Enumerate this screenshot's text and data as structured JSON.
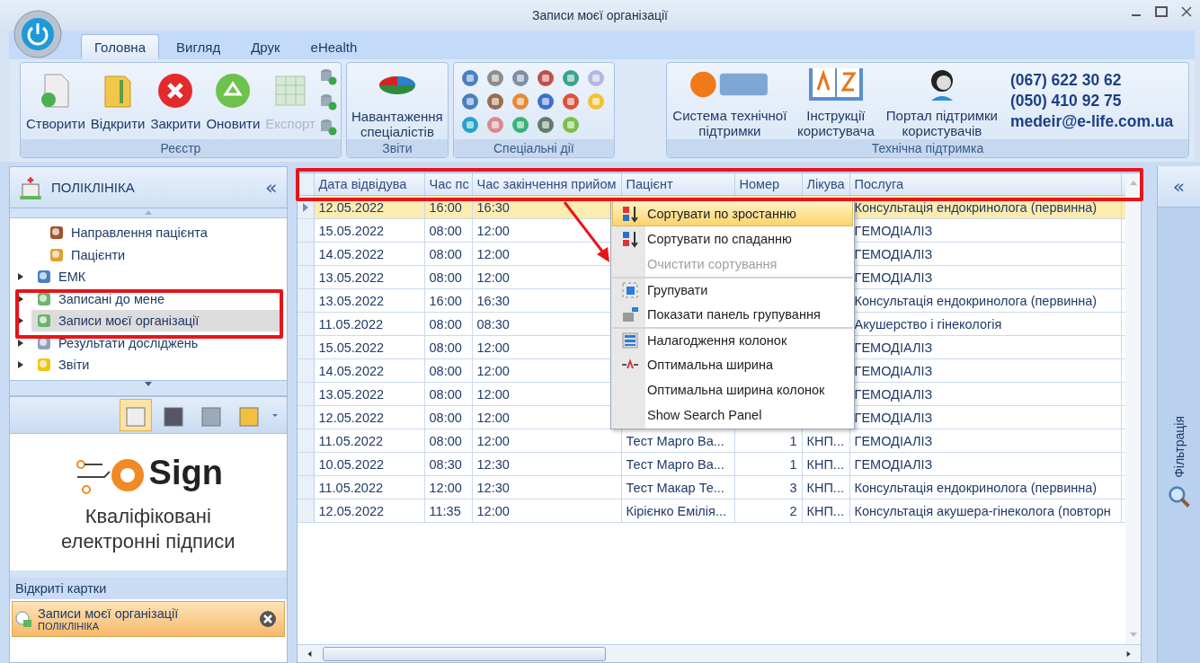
{
  "window": {
    "title": "Записи моєї організації"
  },
  "tabs": [
    {
      "label": "Головна",
      "selected": true
    },
    {
      "label": "Вигляд",
      "selected": false
    },
    {
      "label": "Друк",
      "selected": false
    },
    {
      "label": "eHealth",
      "selected": false
    }
  ],
  "ribbon": {
    "groups": [
      {
        "title": "Реєстр",
        "buttons": [
          {
            "kind": "create",
            "label": "Створити",
            "disabled": false
          },
          {
            "kind": "open",
            "label": "Відкрити",
            "disabled": false
          },
          {
            "kind": "close",
            "label": "Закрити",
            "disabled": false
          },
          {
            "kind": "refresh",
            "label": "Оновити",
            "disabled": false
          },
          {
            "kind": "export",
            "label": "Експорт",
            "disabled": true
          }
        ]
      },
      {
        "title": "Звіти",
        "buttons": [
          {
            "kind": "chart",
            "label": "Навантаження спеціалістів",
            "disabled": false
          }
        ]
      },
      {
        "title": "Спеціальні дії"
      }
    ],
    "support": {
      "title": "Технічна підтримка",
      "buttons": [
        {
          "kind": "ehelp",
          "label": "Система технічної підтримки"
        },
        {
          "kind": "book",
          "label": "Інструкції користувача"
        },
        {
          "kind": "headset",
          "label": "Портал підтримки користувачів"
        }
      ],
      "contacts": [
        "(067) 622 30 62",
        "(050) 410 92 75",
        "medeir@e-life.com.ua"
      ]
    }
  },
  "sidebar": {
    "title": "ПОЛІКЛІНІКА",
    "collapse": "«",
    "tree": [
      {
        "label": "Направлення пацієнта",
        "expandable": false,
        "selected": false
      },
      {
        "label": "Пацієнти",
        "expandable": false,
        "selected": false
      },
      {
        "label": "ЕМК",
        "expandable": true,
        "selected": false
      },
      {
        "label": "Записані до мене",
        "expandable": true,
        "selected": false
      },
      {
        "label": "Записи моєї організації",
        "expandable": true,
        "selected": true
      },
      {
        "label": "Результати досліджень",
        "expandable": true,
        "selected": false
      },
      {
        "label": "Звіти",
        "expandable": true,
        "selected": false
      }
    ],
    "modules": [
      {
        "selected": true
      },
      {
        "selected": false
      },
      {
        "selected": false
      },
      {
        "selected": false
      }
    ],
    "banner": {
      "brand": "Sign",
      "text": "Кваліфіковані електронні підписи"
    },
    "open_cards": {
      "title": "Відкриті картки",
      "items": [
        {
          "title": "Записи моєї організації",
          "subtitle": "ПОЛІКЛІНІКА"
        }
      ]
    }
  },
  "table": {
    "columns": [
      "Дата відвідува",
      "Час пс",
      "Час закінчення прийом",
      "Пацієнт",
      "Номер",
      "Лікува",
      "Послуга"
    ],
    "rows": [
      {
        "selected": true,
        "cells": [
          "12.05.2022",
          "16:00",
          "16:30",
          null,
          null,
          null,
          "Консультація ендокринолога (первинна)"
        ]
      },
      {
        "selected": false,
        "cells": [
          "15.05.2022",
          "08:00",
          "12:00",
          null,
          null,
          null,
          "ГЕМОДІАЛІЗ"
        ]
      },
      {
        "selected": false,
        "cells": [
          "14.05.2022",
          "08:00",
          "12:00",
          null,
          null,
          null,
          "ГЕМОДІАЛІЗ"
        ]
      },
      {
        "selected": false,
        "cells": [
          "13.05.2022",
          "08:00",
          "12:00",
          null,
          null,
          null,
          "ГЕМОДІАЛІЗ"
        ]
      },
      {
        "selected": false,
        "cells": [
          "13.05.2022",
          "16:00",
          "16:30",
          null,
          null,
          null,
          "Консультація ендокринолога (первинна)"
        ]
      },
      {
        "selected": false,
        "cells": [
          "11.05.2022",
          "08:00",
          "08:30",
          null,
          null,
          null,
          "Акушерство і гінекологія"
        ]
      },
      {
        "selected": false,
        "cells": [
          "15.05.2022",
          "08:00",
          "12:00",
          null,
          null,
          null,
          "ГЕМОДІАЛІЗ"
        ]
      },
      {
        "selected": false,
        "cells": [
          "14.05.2022",
          "08:00",
          "12:00",
          null,
          null,
          null,
          "ГЕМОДІАЛІЗ"
        ]
      },
      {
        "selected": false,
        "cells": [
          "13.05.2022",
          "08:00",
          "12:00",
          null,
          null,
          null,
          "ГЕМОДІАЛІЗ"
        ]
      },
      {
        "selected": false,
        "cells": [
          "12.05.2022",
          "08:00",
          "12:00",
          null,
          null,
          null,
          "ГЕМОДІАЛІЗ"
        ]
      },
      {
        "selected": false,
        "cells": [
          "11.05.2022",
          "08:00",
          "12:00",
          "Тест Марго Ва...",
          "1",
          "КНП...",
          "ГЕМОДІАЛІЗ"
        ]
      },
      {
        "selected": false,
        "cells": [
          "10.05.2022",
          "08:30",
          "12:30",
          "Тест Марго Ва...",
          "1",
          "КНП...",
          "ГЕМОДІАЛІЗ"
        ]
      },
      {
        "selected": false,
        "cells": [
          "11.05.2022",
          "12:00",
          "12:30",
          "Тест Макар Те...",
          "3",
          "КНП...",
          "Консультація ендокринолога (первинна)"
        ]
      },
      {
        "selected": false,
        "cells": [
          "12.05.2022",
          "11:35",
          "12:00",
          "Кірієнко Емілія...",
          "2",
          "КНП...",
          "Консультація акушера-гінеколога (повторн"
        ]
      }
    ]
  },
  "context_menu": {
    "items": [
      {
        "kind": "sort-asc",
        "label": "Сортувати по зростанню",
        "selected": true,
        "disabled": false,
        "separator": false
      },
      {
        "kind": "sort-desc",
        "label": "Сортувати по спаданню",
        "selected": false,
        "disabled": false,
        "separator": false
      },
      {
        "kind": "none",
        "label": "Очистити сортування",
        "selected": false,
        "disabled": true,
        "separator": false
      },
      {
        "kind": "group",
        "label": "Групувати",
        "selected": false,
        "disabled": false,
        "separator": true
      },
      {
        "kind": "group-panel",
        "label": "Показати панель групування",
        "selected": false,
        "disabled": false,
        "separator": false
      },
      {
        "kind": "columns",
        "label": "Налагодження колонок",
        "selected": false,
        "disabled": false,
        "separator": true
      },
      {
        "kind": "fit",
        "label": "Оптимальна ширина",
        "selected": false,
        "disabled": false,
        "separator": false
      },
      {
        "kind": "none",
        "label": "Оптимальна ширина колонок",
        "selected": false,
        "disabled": false,
        "separator": false
      },
      {
        "kind": "none",
        "label": "Show Search Panel",
        "selected": false,
        "disabled": false,
        "separator": false
      }
    ]
  },
  "filter_panel": {
    "collapse": "«",
    "label": "Фільтрація"
  }
}
